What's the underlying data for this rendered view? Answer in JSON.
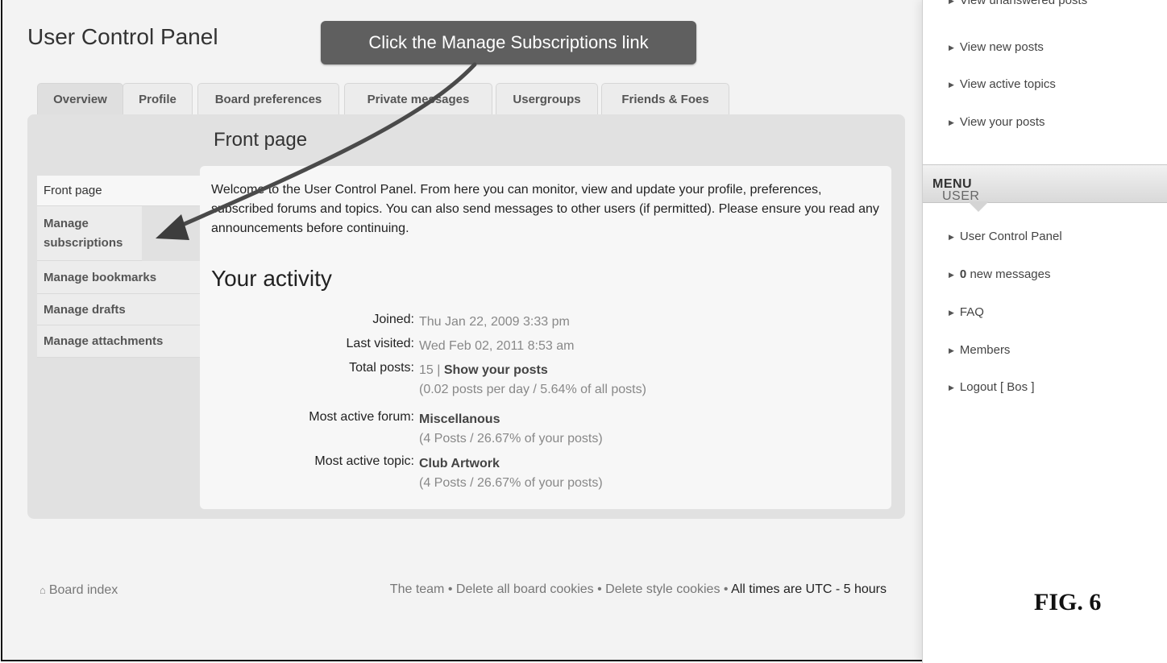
{
  "page": {
    "title": "User Control Panel",
    "callout": "Click the Manage Subscriptions link",
    "figure_label": "FIG. 6"
  },
  "tabs": [
    {
      "label": "Overview",
      "active": true
    },
    {
      "label": "Profile"
    },
    {
      "label": "Board preferences"
    },
    {
      "label": "Private messages"
    },
    {
      "label": "Usergroups"
    },
    {
      "label": "Friends & Foes"
    }
  ],
  "panel": {
    "heading": "Front page",
    "nav": [
      {
        "label": "Front page"
      },
      {
        "label": "Manage subscriptions"
      },
      {
        "label": "Manage bookmarks"
      },
      {
        "label": "Manage drafts"
      },
      {
        "label": "Manage attachments"
      }
    ],
    "intro": "Welcome to the User Control Panel. From here you can monitor, view and update your profile, preferences, subscribed forums and topics. You can also send messages to other users (if permitted). Please ensure you read any announcements before continuing.",
    "activity_title": "Your activity",
    "stats": {
      "joined_label": "Joined:",
      "joined_value": "Thu Jan 22, 2009 3:33 pm",
      "last_label": "Last visited:",
      "last_value": "Wed Feb 02, 2011 8:53 am",
      "posts_label": "Total posts:",
      "posts_count": "15 |",
      "posts_link": "Show your posts",
      "posts_detail": "(0.02 posts per day / 5.64% of all posts)",
      "forum_label": "Most active forum:",
      "forum_link": "Miscellanous",
      "forum_detail": "(4 Posts / 26.67% of your posts)",
      "topic_label": "Most active topic:",
      "topic_link": "Club Artwork",
      "topic_detail": "(4 Posts / 26.67% of your posts)"
    }
  },
  "sidebar": {
    "top_links": [
      {
        "label": "View unanswered posts"
      },
      {
        "label": "View new posts"
      },
      {
        "label": "View active topics"
      },
      {
        "label": "View your posts"
      }
    ],
    "user_menu_prefix": "USER ",
    "user_menu_bold": "MENU",
    "user_links": [
      {
        "label": "User Control Panel"
      },
      {
        "label": "new messages",
        "count": "0"
      },
      {
        "label": "FAQ"
      },
      {
        "label": "Members"
      },
      {
        "label": "Logout [ Bos ]"
      }
    ]
  },
  "footer": {
    "board_index": "Board index",
    "team": "The team",
    "sep": " • ",
    "delete_all": "Delete all board cookies",
    "delete_style": "Delete style cookies",
    "times": "All times are UTC - 5 hours"
  },
  "icons": {
    "arrow_bullet": "triangle-right-icon",
    "home": "home-icon"
  },
  "colors": {
    "callout_bg": "#5f5f5f",
    "panel_bg": "#e1e1e1",
    "content_bg": "#f7f7f7"
  }
}
